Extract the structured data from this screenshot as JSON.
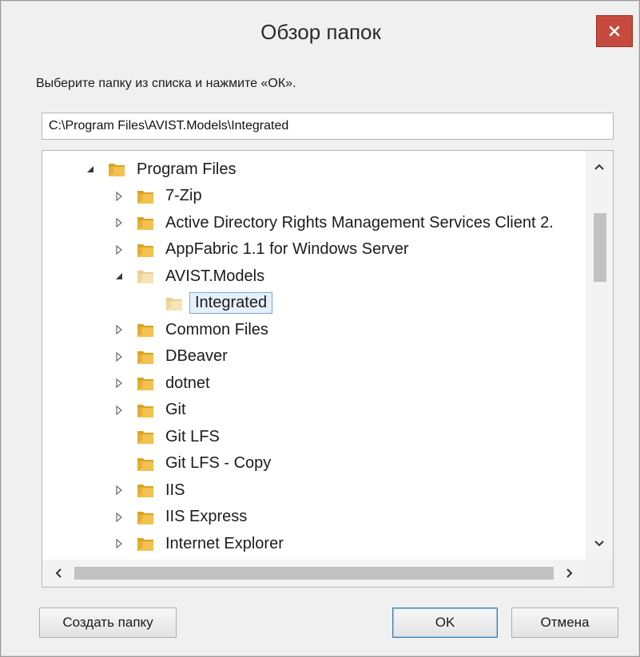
{
  "window": {
    "title": "Обзор папок",
    "close_icon": "close-icon",
    "close_color": "#c64a3d"
  },
  "instruction": "Выберите папку из списка и нажмите «ОК».",
  "path_value": "C:\\Program Files\\AVIST.Models\\Integrated",
  "tree": [
    {
      "label": "Program Files",
      "expander": "expanded",
      "indent": 0,
      "selected": false,
      "folder": "open"
    },
    {
      "label": "7-Zip",
      "expander": "collapsed",
      "indent": 1,
      "selected": false,
      "folder": "normal"
    },
    {
      "label": "Active Directory Rights Management Services Client 2.",
      "expander": "collapsed",
      "indent": 1,
      "selected": false,
      "folder": "normal"
    },
    {
      "label": "AppFabric 1.1 for Windows Server",
      "expander": "collapsed",
      "indent": 1,
      "selected": false,
      "folder": "normal"
    },
    {
      "label": "AVIST.Models",
      "expander": "expanded",
      "indent": 1,
      "selected": false,
      "folder": "pale"
    },
    {
      "label": "Integrated",
      "expander": "none",
      "indent": 2,
      "selected": true,
      "folder": "pale"
    },
    {
      "label": "Common Files",
      "expander": "collapsed",
      "indent": 1,
      "selected": false,
      "folder": "normal"
    },
    {
      "label": "DBeaver",
      "expander": "collapsed",
      "indent": 1,
      "selected": false,
      "folder": "normal"
    },
    {
      "label": "dotnet",
      "expander": "collapsed",
      "indent": 1,
      "selected": false,
      "folder": "normal"
    },
    {
      "label": "Git",
      "expander": "collapsed",
      "indent": 1,
      "selected": false,
      "folder": "normal"
    },
    {
      "label": "Git LFS",
      "expander": "none",
      "indent": 1,
      "selected": false,
      "folder": "normal"
    },
    {
      "label": "Git LFS - Copy",
      "expander": "none",
      "indent": 1,
      "selected": false,
      "folder": "normal"
    },
    {
      "label": "IIS",
      "expander": "collapsed",
      "indent": 1,
      "selected": false,
      "folder": "normal"
    },
    {
      "label": "IIS Express",
      "expander": "collapsed",
      "indent": 1,
      "selected": false,
      "folder": "normal"
    },
    {
      "label": "Internet Explorer",
      "expander": "collapsed",
      "indent": 1,
      "selected": false,
      "folder": "normal"
    }
  ],
  "buttons": {
    "new_folder": "Создать папку",
    "ok": "OK",
    "cancel": "Отмена"
  },
  "icons": {
    "folder": "folder-icon",
    "expand_arrow": "expand-arrow-icon",
    "collapse_arrow": "collapse-arrow-icon",
    "scroll_up": "chevron-up-icon",
    "scroll_down": "chevron-down-icon",
    "scroll_left": "chevron-left-icon",
    "scroll_right": "chevron-right-icon"
  },
  "colors": {
    "folder_yellow": "#f2c14e",
    "selection_border": "#7aa7d8",
    "selection_fill": "#e6f0fb"
  }
}
